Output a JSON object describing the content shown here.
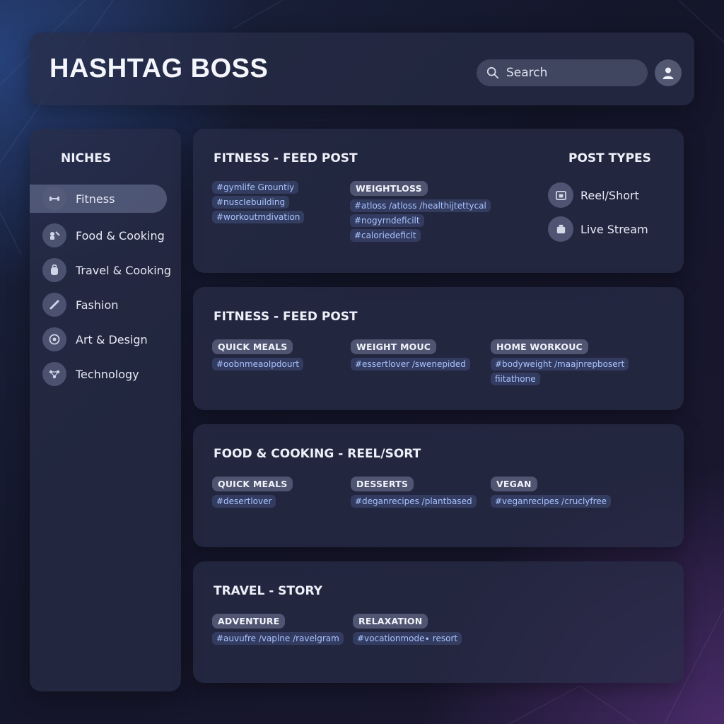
{
  "header": {
    "title": "HASHTAG BOSS",
    "search_placeholder": "Search"
  },
  "sidebar": {
    "title": "NICHES",
    "items": [
      {
        "label": "Fitness",
        "icon": "dumbbell-icon",
        "active": true
      },
      {
        "label": "Food & Cooking",
        "icon": "chef-icon",
        "active": false
      },
      {
        "label": "Travel & Cooking",
        "icon": "backpack-icon",
        "active": false
      },
      {
        "label": "Fashion",
        "icon": "hanger-icon",
        "active": false
      },
      {
        "label": "Art & Design",
        "icon": "palette-icon",
        "active": false
      },
      {
        "label": "Technology",
        "icon": "network-icon",
        "active": false
      }
    ]
  },
  "cards": [
    {
      "title": "FITNESS - FEED POST",
      "columns": [
        {
          "category": "",
          "tags": [
            "#gymlife Grountiy",
            "#nuscIebuilding",
            "#workoutmdivation"
          ]
        },
        {
          "category": "WEIGHTLOSS",
          "tags": [
            "#atloss ∕atloss ∕healthijtettycal",
            "#nogyrndeficilt",
            "#caloriedeficlt"
          ]
        }
      ],
      "post_types": {
        "title": "POST TYPES",
        "items": [
          {
            "label": "Reel/Short",
            "icon": "reel-icon"
          },
          {
            "label": "Live Stream",
            "icon": "live-stream-icon"
          }
        ]
      }
    },
    {
      "title": "FITNESS - FEED POST",
      "columns": [
        {
          "category": "QUICK MEALS",
          "tags": [
            "#oobnmeaoIpdourt"
          ]
        },
        {
          "category": "WEIGHT MOUC",
          "tags": [
            "#essertlover ∕swenepided"
          ]
        },
        {
          "category": "HOME WORKOUC",
          "tags": [
            "#bodyweight ∕maajnrepbosert",
            "fiitathone"
          ]
        }
      ]
    },
    {
      "title": "FOOD & COOKING - REEL/SORT",
      "columns": [
        {
          "category": "QUICK MEALS",
          "tags": [
            "#desertlover"
          ]
        },
        {
          "category": "DESSERTS",
          "tags": [
            "#deganrecipes ∕plantbased"
          ]
        },
        {
          "category": "VEGAN",
          "tags": [
            "#veganrecipes ∕cruclyfree"
          ]
        }
      ]
    },
    {
      "title": "TRAVEL - STORY",
      "columns": [
        {
          "category": "ADVENTURE",
          "tags": [
            "#auvufre ∕vaplne ∕ravelgram"
          ]
        },
        {
          "category": "RELAXATION",
          "tags": [
            "#vocationmode∙ resort"
          ]
        }
      ]
    }
  ]
}
